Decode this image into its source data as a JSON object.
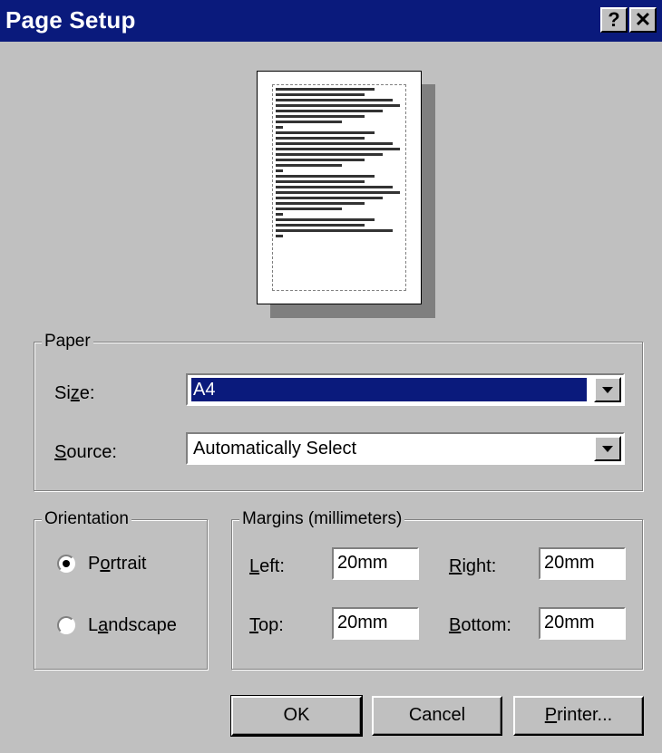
{
  "window": {
    "title": "Page Setup",
    "help_glyph": "?",
    "close_glyph": "✕"
  },
  "paper": {
    "legend": "Paper",
    "size_label": "Size:",
    "size_value": "A4",
    "source_label": "Source:",
    "source_value": "Automatically Select"
  },
  "orientation": {
    "legend": "Orientation",
    "portrait_label": "Portrait",
    "landscape_label": "Landscape",
    "selected": "Portrait"
  },
  "margins": {
    "legend": "Margins (millimeters)",
    "left_label": "Left:",
    "left_value": "20mm",
    "right_label": "Right:",
    "right_value": "20mm",
    "top_label": "Top:",
    "top_value": "20mm",
    "bottom_label": "Bottom:",
    "bottom_value": "20mm"
  },
  "buttons": {
    "ok": "OK",
    "cancel": "Cancel",
    "printer": "Printer..."
  },
  "colors": {
    "title_bar": "#0a1a7c",
    "face": "#c0c0c0",
    "selection": "#0a1a7c"
  }
}
